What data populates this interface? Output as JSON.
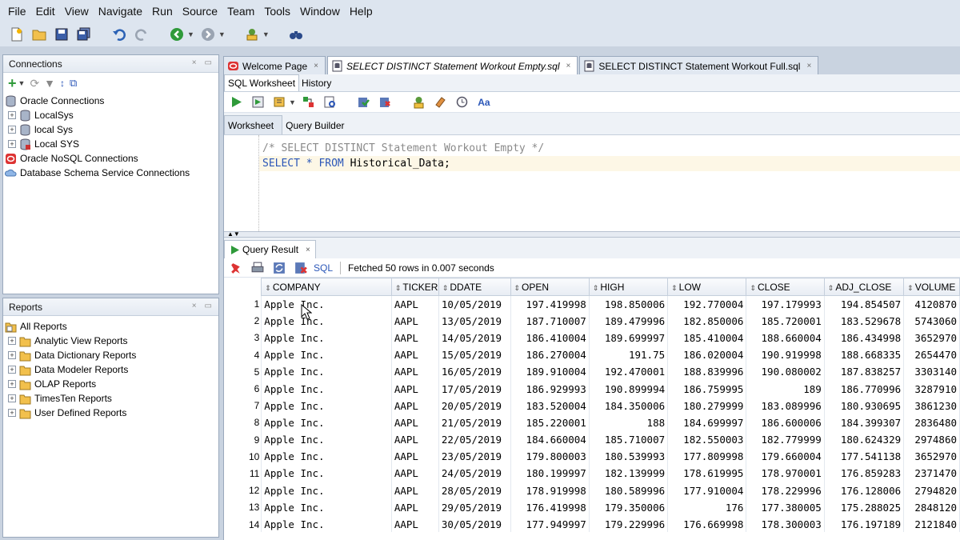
{
  "menu": [
    "File",
    "Edit",
    "View",
    "Navigate",
    "Run",
    "Source",
    "Team",
    "Tools",
    "Window",
    "Help"
  ],
  "connections": {
    "title": "Connections",
    "tree": [
      {
        "label": "Oracle Connections",
        "level": 0
      },
      {
        "label": "LocalSys",
        "level": 1
      },
      {
        "label": "local Sys",
        "level": 1
      },
      {
        "label": "Local SYS",
        "level": 1
      },
      {
        "label": "Oracle NoSQL Connections",
        "level": 0
      },
      {
        "label": "Database Schema Service Connections",
        "level": 0
      }
    ]
  },
  "reports": {
    "title": "Reports",
    "items": [
      "All Reports",
      "Analytic View Reports",
      "Data Dictionary Reports",
      "Data Modeler Reports",
      "OLAP Reports",
      "TimesTen Reports",
      "User Defined Reports"
    ]
  },
  "doc_tabs": [
    {
      "label": "Welcome Page"
    },
    {
      "label": "SELECT DISTINCT Statement Workout Empty.sql"
    },
    {
      "label": "SELECT DISTINCT Statement Workout Full.sql"
    }
  ],
  "subtabs": [
    "SQL Worksheet",
    "History"
  ],
  "worksheet_tabs": [
    "Worksheet",
    "Query Builder"
  ],
  "code": {
    "comment": "/* SELECT DISTINCT Statement Workout Empty */",
    "select": "SELECT",
    "star": "*",
    "from": "FROM",
    "rest": " Historical_Data;"
  },
  "query_result": {
    "tab_label": "Query Result",
    "sql_label": "SQL",
    "status": "Fetched 50 rows in 0.007 seconds",
    "columns": [
      "COMPANY",
      "TICKER",
      "DDATE",
      "OPEN",
      "HIGH",
      "LOW",
      "CLOSE",
      "ADJ_CLOSE",
      "VOLUME"
    ],
    "rows": [
      [
        "1",
        "Apple Inc.",
        "AAPL",
        "10/05/2019",
        "197.419998",
        "198.850006",
        "192.770004",
        "197.179993",
        "194.854507",
        "4120870"
      ],
      [
        "2",
        "Apple Inc.",
        "AAPL",
        "13/05/2019",
        "187.710007",
        "189.479996",
        "182.850006",
        "185.720001",
        "183.529678",
        "5743060"
      ],
      [
        "3",
        "Apple Inc.",
        "AAPL",
        "14/05/2019",
        "186.410004",
        "189.699997",
        "185.410004",
        "188.660004",
        "186.434998",
        "3652970"
      ],
      [
        "4",
        "Apple Inc.",
        "AAPL",
        "15/05/2019",
        "186.270004",
        "191.75",
        "186.020004",
        "190.919998",
        "188.668335",
        "2654470"
      ],
      [
        "5",
        "Apple Inc.",
        "AAPL",
        "16/05/2019",
        "189.910004",
        "192.470001",
        "188.839996",
        "190.080002",
        "187.838257",
        "3303140"
      ],
      [
        "6",
        "Apple Inc.",
        "AAPL",
        "17/05/2019",
        "186.929993",
        "190.899994",
        "186.759995",
        "189",
        "186.770996",
        "3287910"
      ],
      [
        "7",
        "Apple Inc.",
        "AAPL",
        "20/05/2019",
        "183.520004",
        "184.350006",
        "180.279999",
        "183.089996",
        "180.930695",
        "3861230"
      ],
      [
        "8",
        "Apple Inc.",
        "AAPL",
        "21/05/2019",
        "185.220001",
        "188",
        "184.699997",
        "186.600006",
        "184.399307",
        "2836480"
      ],
      [
        "9",
        "Apple Inc.",
        "AAPL",
        "22/05/2019",
        "184.660004",
        "185.710007",
        "182.550003",
        "182.779999",
        "180.624329",
        "2974860"
      ],
      [
        "10",
        "Apple Inc.",
        "AAPL",
        "23/05/2019",
        "179.800003",
        "180.539993",
        "177.809998",
        "179.660004",
        "177.541138",
        "3652970"
      ],
      [
        "11",
        "Apple Inc.",
        "AAPL",
        "24/05/2019",
        "180.199997",
        "182.139999",
        "178.619995",
        "178.970001",
        "176.859283",
        "2371470"
      ],
      [
        "12",
        "Apple Inc.",
        "AAPL",
        "28/05/2019",
        "178.919998",
        "180.589996",
        "177.910004",
        "178.229996",
        "176.128006",
        "2794820"
      ],
      [
        "13",
        "Apple Inc.",
        "AAPL",
        "29/05/2019",
        "176.419998",
        "179.350006",
        "176",
        "177.380005",
        "175.288025",
        "2848120"
      ],
      [
        "14",
        "Apple Inc.",
        "AAPL",
        "30/05/2019",
        "177.949997",
        "179.229996",
        "176.669998",
        "178.300003",
        "176.197189",
        "2121840"
      ]
    ]
  }
}
